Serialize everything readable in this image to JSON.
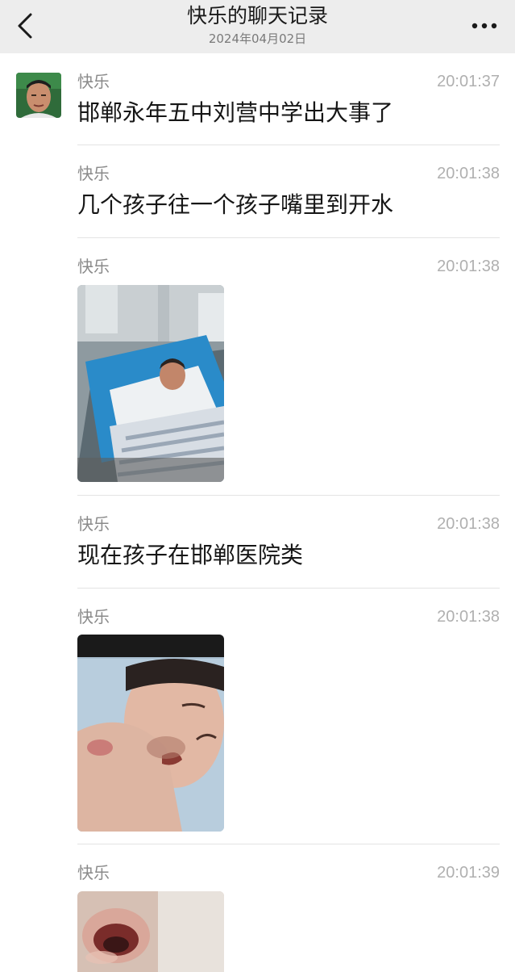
{
  "header": {
    "title": "快乐的聊天记录",
    "date": "2024年04月02日",
    "back_icon": "chevron-left-icon",
    "more_icon": "more-dots-icon"
  },
  "messages": [
    {
      "sender": "快乐",
      "time": "20:01:37",
      "text": "邯郸永年五中刘营中学出大事了"
    },
    {
      "sender": "快乐",
      "time": "20:01:38",
      "text": "几个孩子往一个孩子嘴里到开水"
    },
    {
      "sender": "快乐",
      "time": "20:01:38",
      "image": "photo-hospital-bed"
    },
    {
      "sender": "快乐",
      "time": "20:01:38",
      "text": "现在孩子在邯郸医院类"
    },
    {
      "sender": "快乐",
      "time": "20:01:38",
      "image": "photo-child-burn-face"
    },
    {
      "sender": "快乐",
      "time": "20:01:39",
      "image": "photo-mouth-injury"
    }
  ],
  "colors": {
    "header_bg": "#ededed",
    "page_bg": "#ffffff",
    "sender": "#8a8a8a",
    "time": "#b0b0b0",
    "text": "#161616",
    "divider": "#e3e3e3"
  }
}
